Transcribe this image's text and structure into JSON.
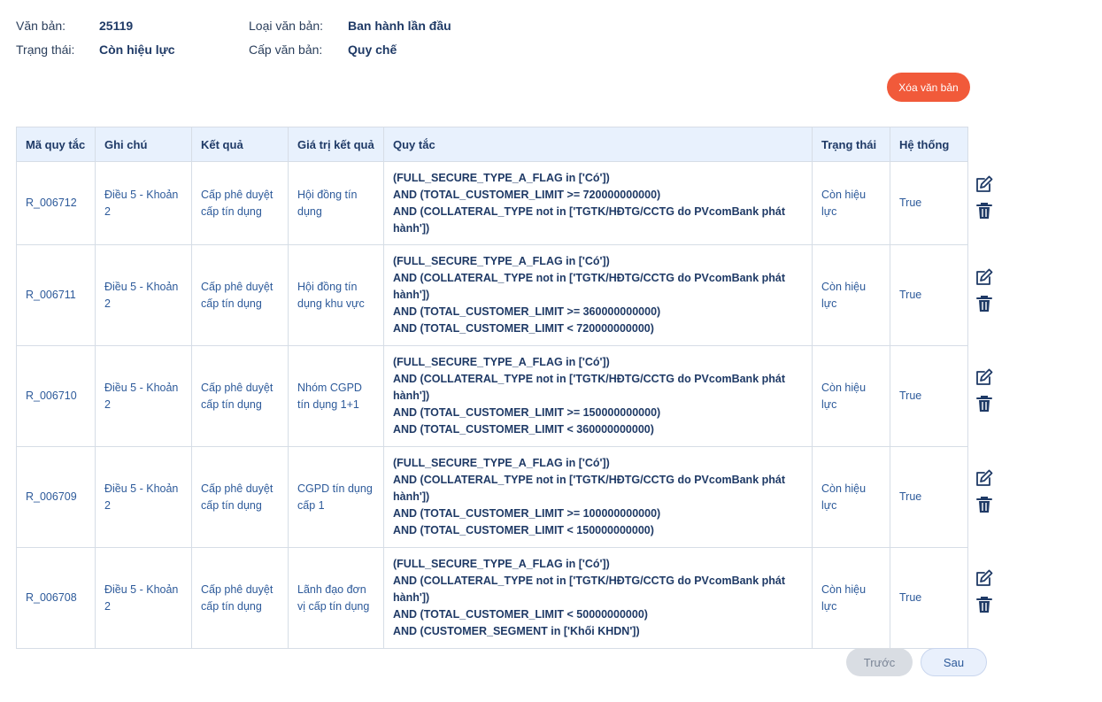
{
  "document": {
    "labels": {
      "doc": "Văn bản:",
      "status": "Trạng thái:",
      "type": "Loại văn bản:",
      "level": "Cấp văn bản:"
    },
    "doc_number": "25119",
    "status": "Còn hiệu lực",
    "type": "Ban hành lần đầu",
    "level": "Quy chế"
  },
  "actions": {
    "delete_document": "Xóa văn bản"
  },
  "table": {
    "columns": [
      "Mã quy tắc",
      "Ghi chú",
      "Kết quả",
      "Giá trị kết quả",
      "Quy tắc",
      "Trạng thái",
      "Hệ thống"
    ],
    "rows": [
      {
        "code": "R_006712",
        "note": "Điều 5 - Khoản 2",
        "result": "Cấp phê duyệt cấp tín dụng",
        "result_value": "Hội đồng tín dụng",
        "rule_lines": [
          "(FULL_SECURE_TYPE_A_FLAG in ['Có'])",
          "AND (TOTAL_CUSTOMER_LIMIT >= 720000000000)",
          "AND (COLLATERAL_TYPE not in ['TGTK/HĐTG/CCTG do PVcomBank phát hành'])"
        ],
        "status": "Còn hiệu lực",
        "system": "True"
      },
      {
        "code": "R_006711",
        "note": "Điều 5 - Khoản 2",
        "result": "Cấp phê duyệt cấp tín dụng",
        "result_value": "Hội đồng tín dụng khu vực",
        "rule_lines": [
          "(FULL_SECURE_TYPE_A_FLAG in ['Có'])",
          "AND (COLLATERAL_TYPE not in ['TGTK/HĐTG/CCTG do PVcomBank phát hành'])",
          "AND (TOTAL_CUSTOMER_LIMIT >= 360000000000)",
          "AND (TOTAL_CUSTOMER_LIMIT < 720000000000)"
        ],
        "status": "Còn hiệu lực",
        "system": "True"
      },
      {
        "code": "R_006710",
        "note": "Điều 5 - Khoản 2",
        "result": "Cấp phê duyệt cấp tín dụng",
        "result_value": "Nhóm CGPD tín dụng 1+1",
        "rule_lines": [
          "(FULL_SECURE_TYPE_A_FLAG in ['Có'])",
          "AND (COLLATERAL_TYPE not in ['TGTK/HĐTG/CCTG do PVcomBank phát hành'])",
          "AND (TOTAL_CUSTOMER_LIMIT >= 150000000000)",
          "AND (TOTAL_CUSTOMER_LIMIT < 360000000000)"
        ],
        "status": "Còn hiệu lực",
        "system": "True"
      },
      {
        "code": "R_006709",
        "note": "Điều 5 - Khoản 2",
        "result": "Cấp phê duyệt cấp tín dụng",
        "result_value": "CGPD tín dụng cấp 1",
        "rule_lines": [
          "(FULL_SECURE_TYPE_A_FLAG in ['Có'])",
          "AND (COLLATERAL_TYPE not in ['TGTK/HĐTG/CCTG do PVcomBank phát hành'])",
          "AND (TOTAL_CUSTOMER_LIMIT >= 100000000000)",
          "AND (TOTAL_CUSTOMER_LIMIT < 150000000000)"
        ],
        "status": "Còn hiệu lực",
        "system": "True"
      },
      {
        "code": "R_006708",
        "note": "Điều 5 - Khoản 2",
        "result": "Cấp phê duyệt cấp tín dụng",
        "result_value": "Lãnh đạo đơn vị cấp tín dụng",
        "rule_lines": [
          "(FULL_SECURE_TYPE_A_FLAG in ['Có'])",
          "AND (COLLATERAL_TYPE not in ['TGTK/HĐTG/CCTG do PVcomBank phát hành'])",
          "AND (TOTAL_CUSTOMER_LIMIT < 50000000000)",
          "AND (CUSTOMER_SEGMENT in ['Khối KHDN'])"
        ],
        "status": "Còn hiệu lực",
        "system": "True"
      }
    ],
    "row_actions": {
      "edit_icon": "edit-icon",
      "delete_icon": "trash-icon"
    }
  },
  "pagination": {
    "prev": "Trước",
    "next": "Sau"
  },
  "colors": {
    "accent": "#f15a3a",
    "header_bg": "#e8f1fd",
    "text_dark": "#1f3a66",
    "text_link": "#2d5a9a"
  }
}
